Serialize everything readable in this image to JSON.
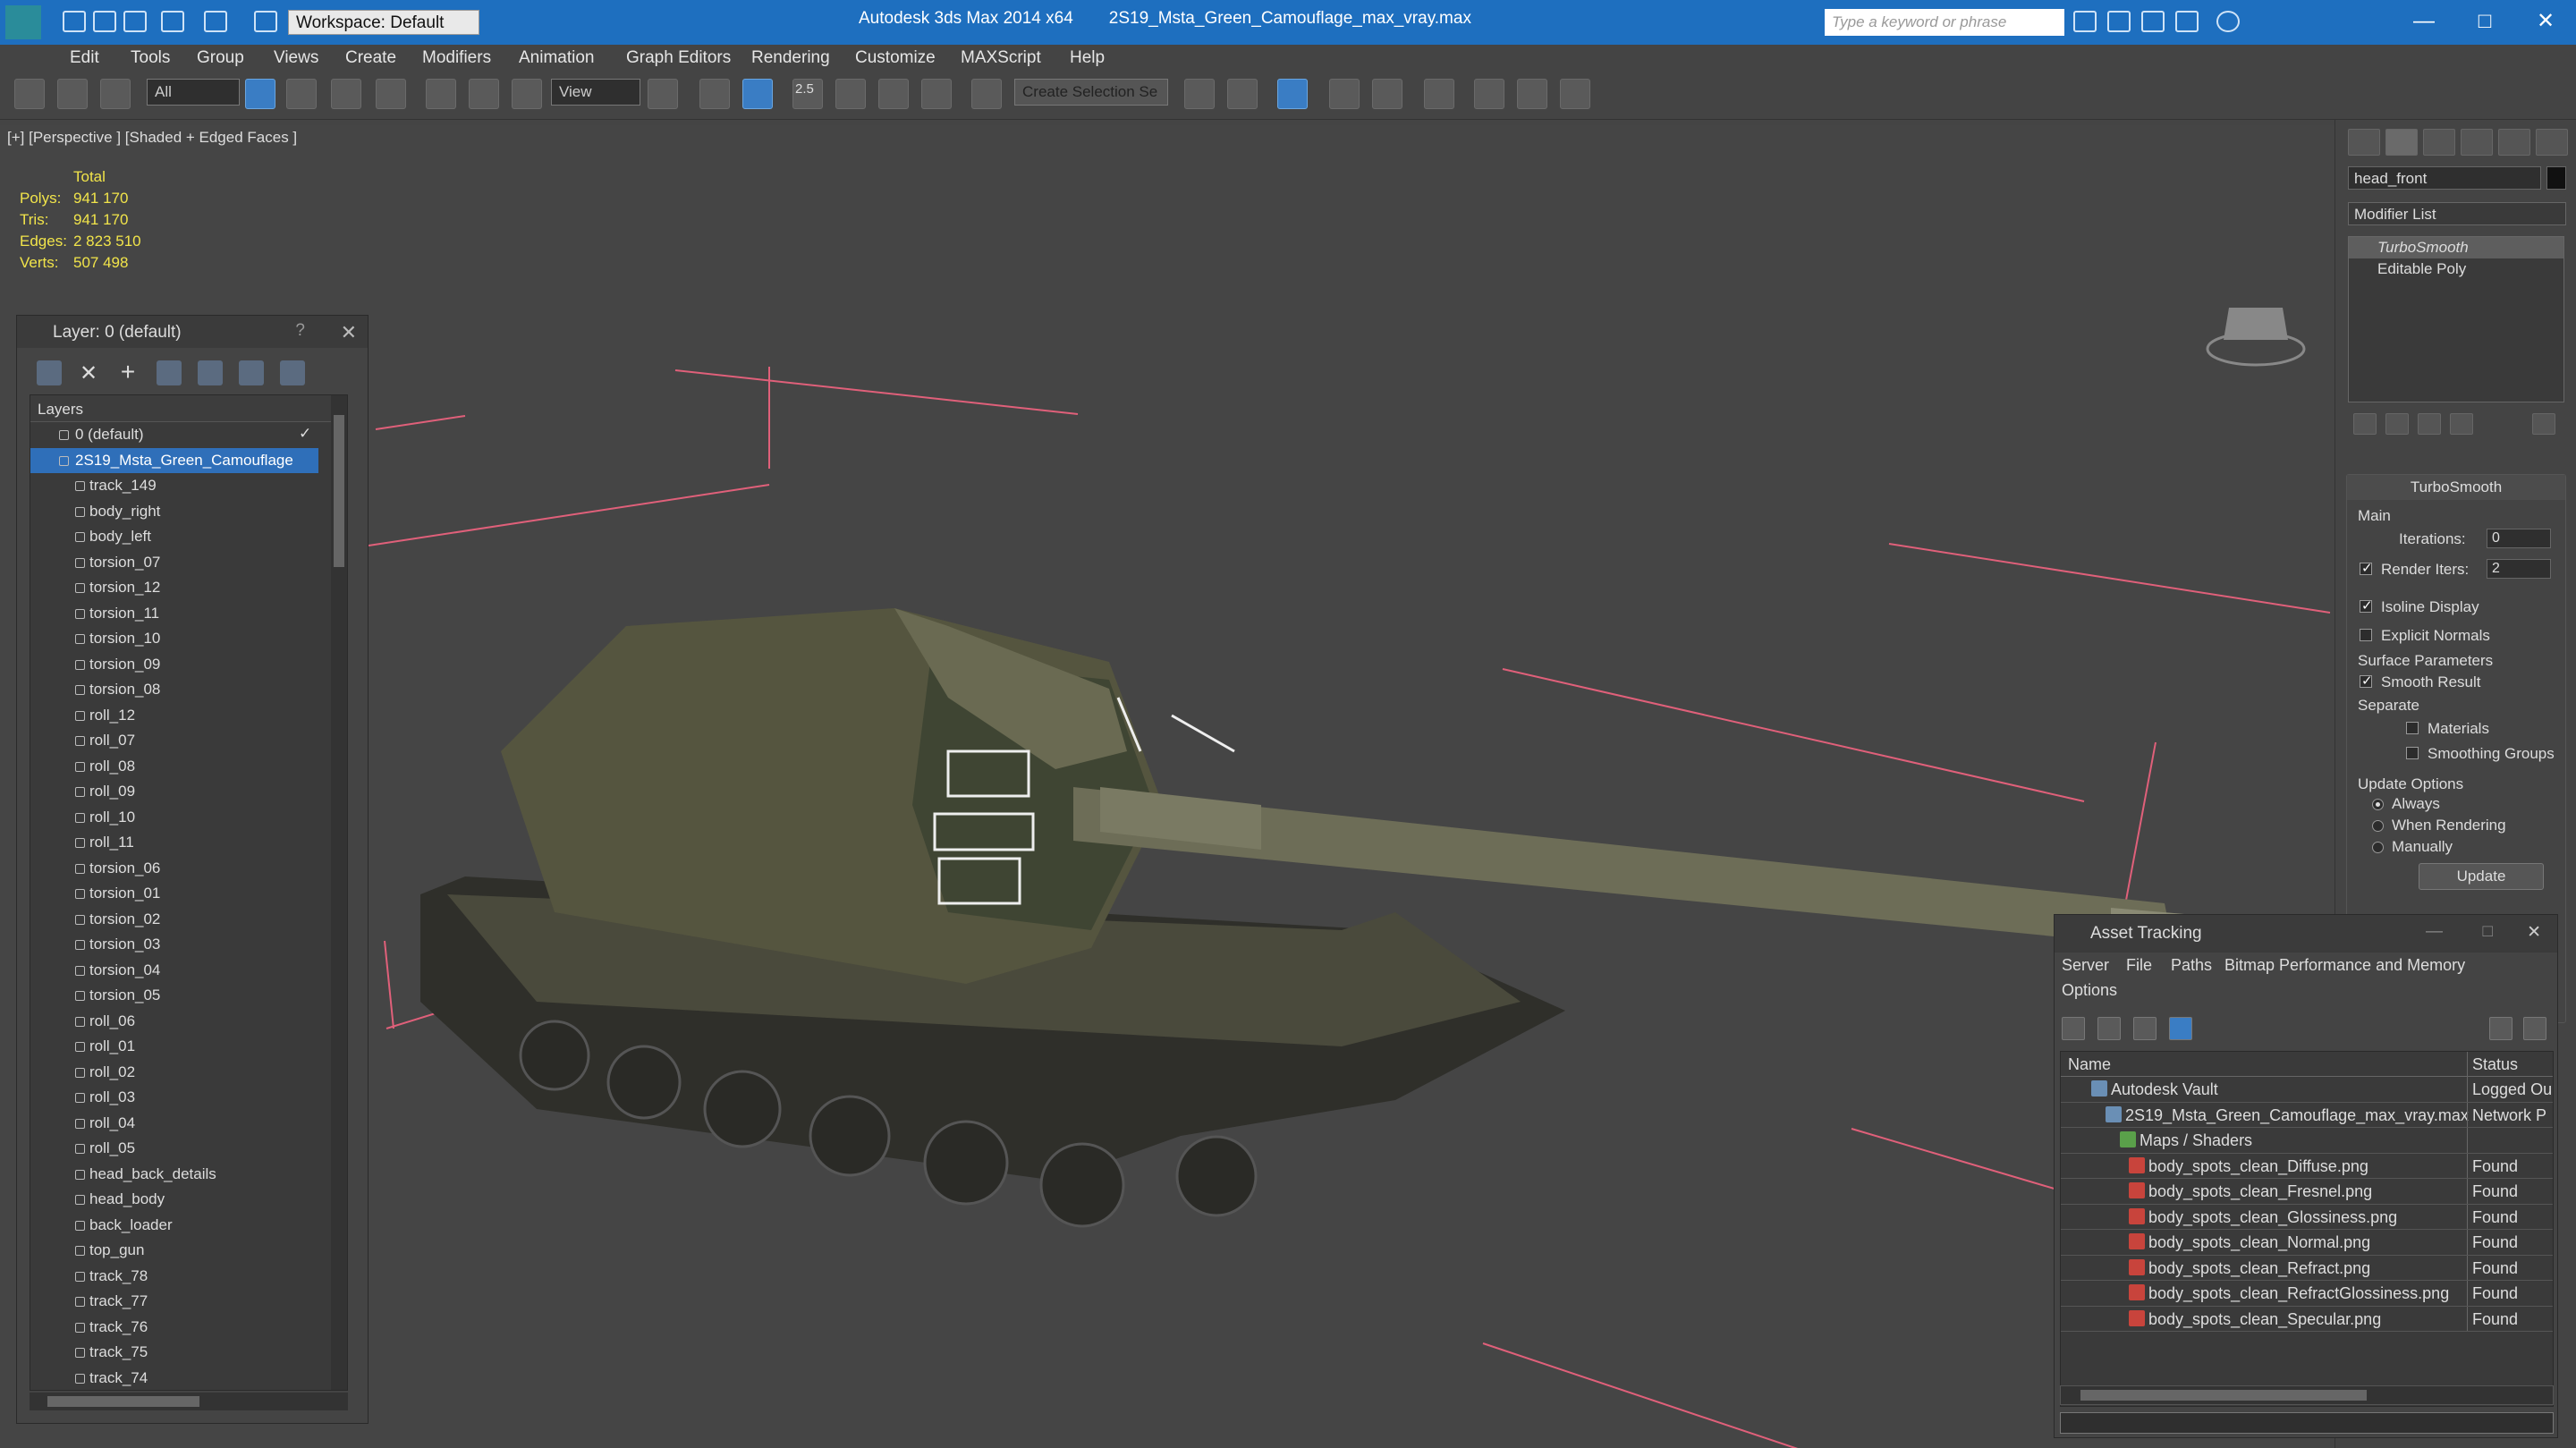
{
  "titlebar": {
    "app": "Autodesk 3ds Max  2014 x64",
    "file": "2S19_Msta_Green_Camouflage_max_vray.max",
    "workspace": "Workspace: Default",
    "search_placeholder": "Type a keyword or phrase"
  },
  "menu": [
    "Edit",
    "Tools",
    "Group",
    "Views",
    "Create",
    "Modifiers",
    "Animation",
    "Graph Editors",
    "Rendering",
    "Customize",
    "MAXScript",
    "Help"
  ],
  "toolbar": {
    "filter": "All",
    "refcoord": "View",
    "snap_label": "2.5",
    "selection_set": "Create Selection Se"
  },
  "viewport": {
    "label": "[+] [Perspective ] [Shaded + Edged Faces ]",
    "stats_header": "Total",
    "stats": [
      {
        "k": "Polys:",
        "v": "941 170"
      },
      {
        "k": "Tris:",
        "v": "941 170"
      },
      {
        "k": "Edges:",
        "v": "2 823 510"
      },
      {
        "k": "Verts:",
        "v": "507 498"
      }
    ]
  },
  "layers": {
    "title": "Layer: 0 (default)",
    "help": "?",
    "column": "Layers",
    "items": [
      {
        "name": "0 (default)",
        "level": 0
      },
      {
        "name": "2S19_Msta_Green_Camouflage",
        "level": 0,
        "selected": true
      },
      {
        "name": "track_149"
      },
      {
        "name": "body_right"
      },
      {
        "name": "body_left"
      },
      {
        "name": "torsion_07"
      },
      {
        "name": "torsion_12"
      },
      {
        "name": "torsion_11"
      },
      {
        "name": "torsion_10"
      },
      {
        "name": "torsion_09"
      },
      {
        "name": "torsion_08"
      },
      {
        "name": "roll_12"
      },
      {
        "name": "roll_07"
      },
      {
        "name": "roll_08"
      },
      {
        "name": "roll_09"
      },
      {
        "name": "roll_10"
      },
      {
        "name": "roll_11"
      },
      {
        "name": "torsion_06"
      },
      {
        "name": "torsion_01"
      },
      {
        "name": "torsion_02"
      },
      {
        "name": "torsion_03"
      },
      {
        "name": "torsion_04"
      },
      {
        "name": "torsion_05"
      },
      {
        "name": "roll_06"
      },
      {
        "name": "roll_01"
      },
      {
        "name": "roll_02"
      },
      {
        "name": "roll_03"
      },
      {
        "name": "roll_04"
      },
      {
        "name": "roll_05"
      },
      {
        "name": "head_back_details"
      },
      {
        "name": "head_body"
      },
      {
        "name": "back_loader"
      },
      {
        "name": "top_gun"
      },
      {
        "name": "track_78"
      },
      {
        "name": "track_77"
      },
      {
        "name": "track_76"
      },
      {
        "name": "track_75"
      },
      {
        "name": "track_74"
      }
    ]
  },
  "command_panel": {
    "object_name": "head_front",
    "modifier_list": "Modifier List",
    "stack": [
      "TurboSmooth",
      "Editable Poly"
    ],
    "turbosmooth": {
      "title": "TurboSmooth",
      "main": "Main",
      "iterations_label": "Iterations:",
      "iterations": "0",
      "render_iters_label": "Render Iters:",
      "render_iters": "2",
      "isoline": "Isoline Display",
      "explicit": "Explicit Normals",
      "surface": "Surface Parameters",
      "smooth": "Smooth Result",
      "separate": "Separate",
      "materials": "Materials",
      "smoothing_groups": "Smoothing Groups",
      "update_options": "Update Options",
      "always": "Always",
      "when_rendering": "When Rendering",
      "manually": "Manually",
      "update_btn": "Update"
    }
  },
  "asset_tracking": {
    "title": "Asset Tracking",
    "menu": [
      "Server",
      "File",
      "Paths",
      "Bitmap Performance and Memory"
    ],
    "options": "Options",
    "col_name": "Name",
    "col_status": "Status",
    "rows": [
      {
        "name": "Autodesk Vault",
        "status": "Logged Ou",
        "indent": 1
      },
      {
        "name": "2S19_Msta_Green_Camouflage_max_vray.max",
        "status": "Network P",
        "indent": 2
      },
      {
        "name": "Maps / Shaders",
        "status": "",
        "indent": 3
      },
      {
        "name": "body_spots_clean_Diffuse.png",
        "status": "Found",
        "indent": 4
      },
      {
        "name": "body_spots_clean_Fresnel.png",
        "status": "Found",
        "indent": 4
      },
      {
        "name": "body_spots_clean_Glossiness.png",
        "status": "Found",
        "indent": 4
      },
      {
        "name": "body_spots_clean_Normal.png",
        "status": "Found",
        "indent": 4
      },
      {
        "name": "body_spots_clean_Refract.png",
        "status": "Found",
        "indent": 4
      },
      {
        "name": "body_spots_clean_RefractGlossiness.png",
        "status": "Found",
        "indent": 4
      },
      {
        "name": "body_spots_clean_Specular.png",
        "status": "Found",
        "indent": 4
      }
    ]
  },
  "colors": {
    "titlebar": "#1e6fbf",
    "selection": "#2f6fb9",
    "stats": "#f1e44a",
    "bbox_lines": "#e0607a"
  }
}
